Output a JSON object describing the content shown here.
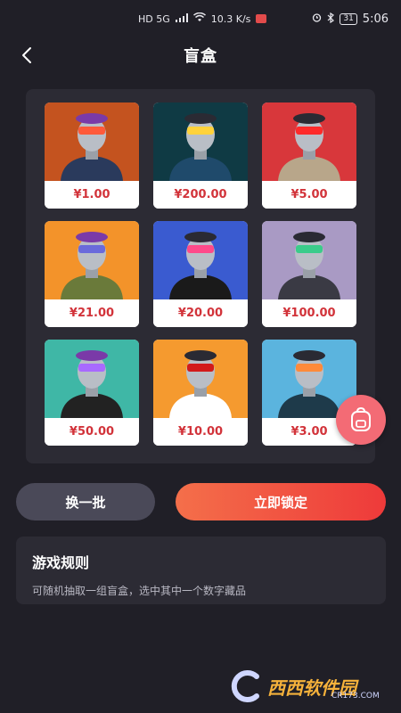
{
  "status_bar": {
    "network": "HD 5G",
    "speed": "10.3 K/s",
    "battery": "31",
    "time": "5:06"
  },
  "header": {
    "title": "盲盒"
  },
  "cards": [
    {
      "price": "¥1.00",
      "bg": "#c4531f"
    },
    {
      "price": "¥200.00",
      "bg": "#0f3a44"
    },
    {
      "price": "¥5.00",
      "bg": "#d8373b"
    },
    {
      "price": "¥21.00",
      "bg": "#f3932a"
    },
    {
      "price": "¥20.00",
      "bg": "#3a5bd0"
    },
    {
      "price": "¥100.00",
      "bg": "#a99ac4"
    },
    {
      "price": "¥50.00",
      "bg": "#3fb7a6"
    },
    {
      "price": "¥10.00",
      "bg": "#f59a2f"
    },
    {
      "price": "¥3.00",
      "bg": "#5bb4de"
    }
  ],
  "actions": {
    "change_label": "换一批",
    "lock_label": "立即锁定"
  },
  "rules": {
    "title": "游戏规则",
    "description": "可随机抽取一组盲盒，选中其中一个数字藏品"
  },
  "floating_button": {
    "icon": "backpack-icon"
  },
  "watermark": {
    "brand": "西西软件园",
    "url": "CR173.COM"
  },
  "colors": {
    "page_bg": "#201f27",
    "panel_bg": "#2c2b34",
    "price_red": "#d2333a",
    "accent_start": "#f46f4a",
    "accent_end": "#ee3a3a",
    "float_pink": "#f36b75"
  }
}
